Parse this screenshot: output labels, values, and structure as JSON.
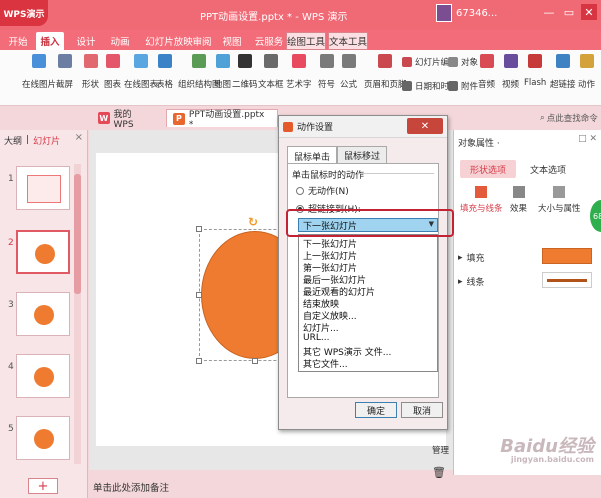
{
  "app": {
    "logo": "WPS演示",
    "title": "PPT动画设置.pptx * - WPS 演示",
    "account_name": "67346...",
    "win_controls": [
      "—",
      "▭",
      "✕"
    ]
  },
  "menu_tabs": [
    {
      "label": "开始",
      "x": 0
    },
    {
      "label": "插入",
      "x": 0
    },
    {
      "label": "设计",
      "x": 0
    },
    {
      "label": "动画",
      "x": 0
    },
    {
      "label": "幻灯片放映",
      "x": 0
    },
    {
      "label": "审阅",
      "x": 0
    },
    {
      "label": "视图",
      "x": 0
    },
    {
      "label": "云服务",
      "x": 0
    },
    {
      "label": "绘图工具",
      "x": 0
    },
    {
      "label": "文本工具",
      "x": 0
    }
  ],
  "ribbon": {
    "buttons": [
      "在线图片",
      "截屏",
      "形状",
      "图表",
      "在线图表",
      "表格",
      "组织结构图",
      "地图",
      "二维码",
      "文本框",
      "艺术字",
      "符号",
      "公式",
      "页眉和页脚"
    ],
    "small": {
      "slide_number": "幻灯片编号",
      "object": "对象",
      "datetime": "日期和时间",
      "attachment": "附件",
      "audio": "音频",
      "video": "视频",
      "flash": "Flash",
      "hyperlink": "超链接",
      "action": "动作"
    }
  },
  "doc_tabs": {
    "home": "我的WPS",
    "doc": "PPT动画设置.pptx *",
    "search": "点此查找命令"
  },
  "slide_panel": {
    "tab_outline": "大纲",
    "tab_slides": "幻灯片",
    "close": "×",
    "numbers": [
      "1",
      "2",
      "3",
      "4",
      "5"
    ],
    "add": "+"
  },
  "notes_placeholder": "单击此处添加备注",
  "vertical_tools": {
    "hide": "管理"
  },
  "props": {
    "title": "对象属性 ·",
    "tab_shape": "形状选项",
    "tab_text": "文本选项",
    "sub_fill": "填充与线条",
    "sub_effect": "效果",
    "sub_size": "大小与属性",
    "row_fill": "填充",
    "row_line": "线条",
    "fill_color": "#ee7b2f",
    "line_color": "#b25319"
  },
  "badge": "68",
  "watermark": {
    "main": "Baidu经验",
    "sub": "jingyan.baidu.com"
  },
  "dialog": {
    "title": "动作设置",
    "close": "✕",
    "tab_click": "鼠标单击",
    "tab_hover": "鼠标移过",
    "section": "单击鼠标时的动作",
    "radio_none": "无动作(N)",
    "radio_link": "超链接到(H):",
    "selected": "下一张幻灯片",
    "options": [
      "下一张幻灯片",
      "上一张幻灯片",
      "第一张幻灯片",
      "最后一张幻灯片",
      "最近观看的幻灯片",
      "结束放映",
      "自定义放映...",
      "幻灯片...",
      "URL...",
      "其它 WPS演示 文件...",
      "其它文件..."
    ],
    "ok": "确定",
    "cancel": "取消"
  }
}
